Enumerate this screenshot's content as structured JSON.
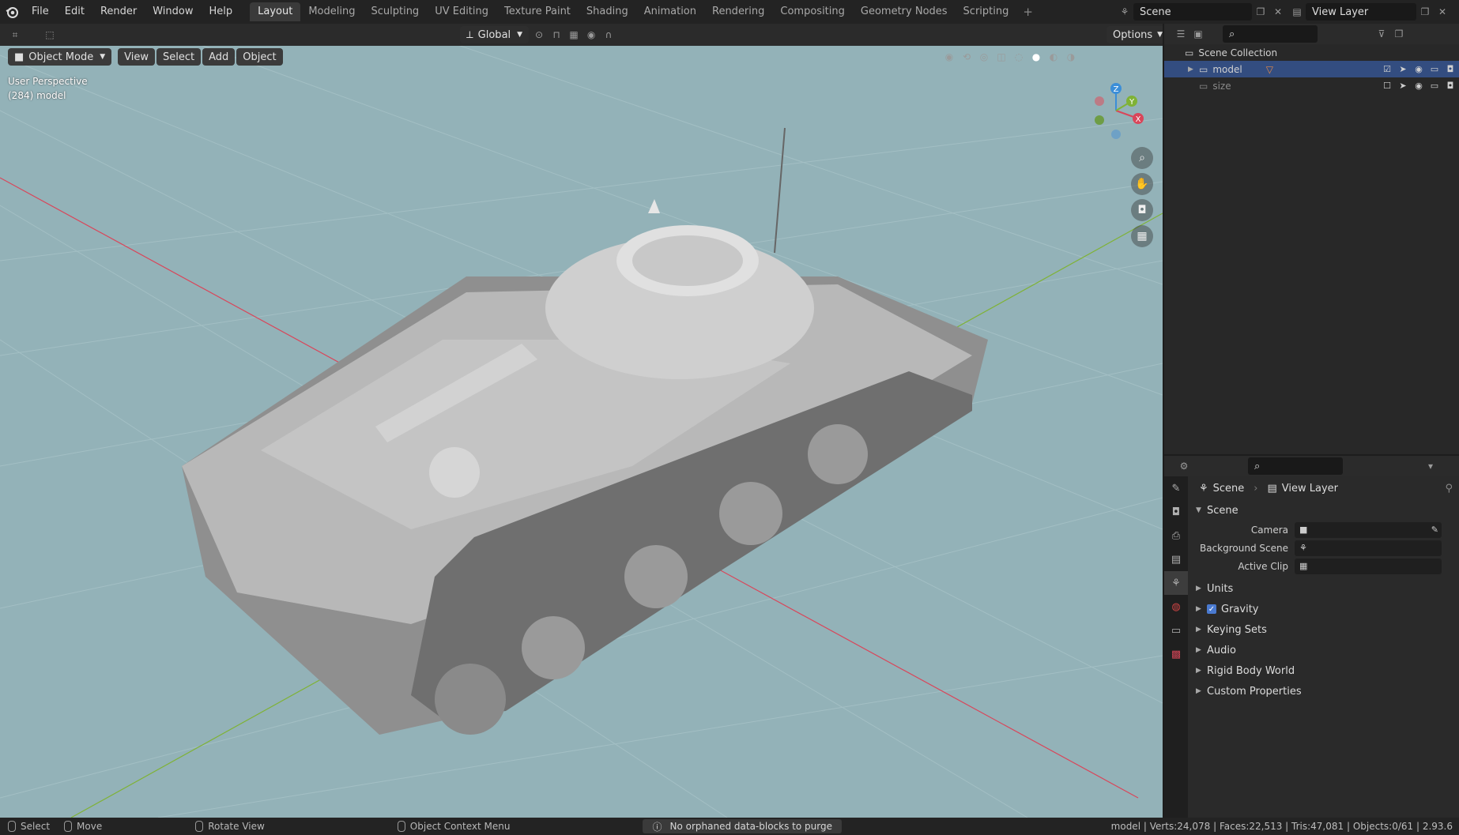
{
  "menu": [
    "File",
    "Edit",
    "Render",
    "Window",
    "Help"
  ],
  "workspaces": [
    "Layout",
    "Modeling",
    "Sculpting",
    "UV Editing",
    "Texture Paint",
    "Shading",
    "Animation",
    "Rendering",
    "Compositing",
    "Geometry Nodes",
    "Scripting"
  ],
  "active_workspace": "Layout",
  "scene_name": "Scene",
  "view_layer_name": "View Layer",
  "viewport": {
    "transform_orientation": "Global",
    "options_label": "Options",
    "mode": "Object Mode",
    "menus": [
      "View",
      "Select",
      "Add",
      "Object"
    ],
    "perspective_text": "User Perspective",
    "object_text": "(284) model",
    "gizmo": {
      "x": "X",
      "y": "Y",
      "z": "Z"
    }
  },
  "outliner": {
    "root": "Scene Collection",
    "items": [
      {
        "name": "model",
        "selected": true,
        "checked": true
      },
      {
        "name": "size",
        "selected": false,
        "checked": false
      }
    ]
  },
  "properties": {
    "breadcrumb_scene": "Scene",
    "breadcrumb_layer": "View Layer",
    "section_title": "Scene",
    "fields": [
      {
        "label": "Camera"
      },
      {
        "label": "Background Scene"
      },
      {
        "label": "Active Clip"
      }
    ],
    "panels": [
      "Units",
      "Gravity",
      "Keying Sets",
      "Audio",
      "Rigid Body World",
      "Custom Properties"
    ]
  },
  "statusbar": {
    "select": "Select",
    "move": "Move",
    "rotate": "Rotate View",
    "context": "Object Context Menu",
    "info": "No orphaned data-blocks to purge",
    "stats": "model | Verts:24,078 | Faces:22,513 | Tris:47,081 | Objects:0/61 | 2.93.6"
  },
  "colors": {
    "viewport_bg": "#93b2b8",
    "x_axis": "#d9465a",
    "y_axis": "#7fb236",
    "z_axis": "#3b8ed8",
    "selection": "#334d80"
  }
}
